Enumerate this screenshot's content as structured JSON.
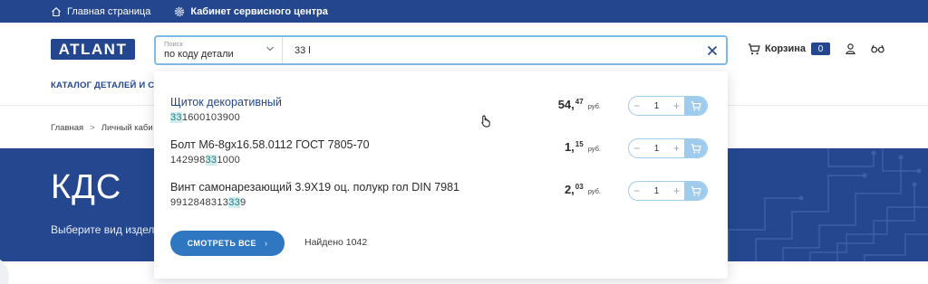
{
  "topbar": {
    "home": "Главная страница",
    "service": "Кабинет сервисного центра"
  },
  "header": {
    "logo": "ATLANT",
    "search": {
      "mode_label": "Поиск",
      "mode_value": "по коду детали",
      "query": "33 l"
    },
    "cart_label": "Корзина",
    "cart_count": "0"
  },
  "nav": {
    "catalog": "КАТАЛОГ ДЕТАЛЕЙ И СБО"
  },
  "breadcrumb": {
    "home": "Главная",
    "sep": ">",
    "current": "Личный каби"
  },
  "hero": {
    "title": "КДС",
    "subtitle": "Выберите вид издел"
  },
  "results": [
    {
      "name": "Щиток декоративный",
      "code_pre": "",
      "code_hl": "33",
      "code_post": "1600103900",
      "price_int": "54,",
      "price_dec": "47",
      "currency": "руб.",
      "qty": "1"
    },
    {
      "name": "Болт М6-8gх16.58.0112 ГОСТ 7805-70",
      "code_pre": "142998",
      "code_hl": "33",
      "code_post": "1000",
      "price_int": "1,",
      "price_dec": "15",
      "currency": "руб.",
      "qty": "1"
    },
    {
      "name": "Винт самонарезающий 3.9Х19 оц. полукр гол DIN 7981",
      "code_pre": "9912848313",
      "code_hl": "33",
      "code_post": "9",
      "price_int": "2,",
      "price_dec": "03",
      "currency": "руб.",
      "qty": "1"
    }
  ],
  "qty_controls": {
    "minus": "−",
    "plus": "+"
  },
  "dropdown_footer": {
    "show_all": "СМОТРЕТЬ ВСЕ",
    "arrow": "›",
    "found": "Найдено 1042"
  },
  "colors": {
    "brand": "#23468e",
    "accent": "#2f77c1",
    "highlight": "#d2ecec"
  },
  "icons": [
    "home-icon",
    "gear-icon",
    "chevron-down-icon",
    "close-icon",
    "cart-icon",
    "user-icon",
    "compare-icon",
    "add-to-cart-icon",
    "pointer-cursor-icon"
  ]
}
